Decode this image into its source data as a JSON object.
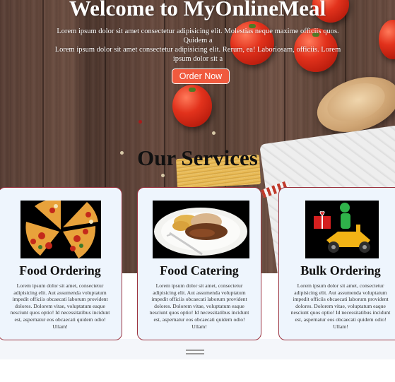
{
  "header": {
    "title": "Welcome to MyOnlineMeal",
    "intro_line1": "Lorem ipsum dolor sit amet consectetur adipisicing elit. Molestias neque maxime officiis quos. Quidem a",
    "intro_line2": "Lorem ipsum dolor sit amet consectetur adipisicing elit. Rerum, ea! Laboriosam, officiis. Lorem ipsum dolor sit a",
    "order_button": "Order Now"
  },
  "services": {
    "heading": "Our Services",
    "cards": [
      {
        "title": "Food Ordering",
        "icon": "pizza-image",
        "text": "Lorem ipsum dolor sit amet, consectetur adipisicing elit. Aut assumenda voluptatum impedit officiis obcaecati laborum provident dolores. Dolorem vitae, voluptatum eaque nesciunt quos optio! Id necessitatibus incidunt est, aspernatur eos obcaecati quidem odio! Ullam!"
      },
      {
        "title": "Food Catering",
        "icon": "plated-meal-image",
        "text": "Lorem ipsum dolor sit amet, consectetur adipisicing elit. Aut assumenda voluptatum impedit officiis obcaecati laborum provident dolores. Dolorem vitae, voluptatum eaque nesciunt quos optio! Id necessitatibus incidunt est, aspernatur eos obcaecati quidem odio! Ullam!"
      },
      {
        "title": "Bulk Ordering",
        "icon": "delivery-scooter-image",
        "text": "Lorem ipsum dolor sit amet, consectetur adipisicing elit. Aut assumenda voluptatum impedit officiis obcaecati laborum provident dolores. Dolorem vitae, voluptatum eaque nesciunt quos optio! Id necessitatibus incidunt est, aspernatur eos obcaecati quidem odio! Ullam!"
      }
    ]
  },
  "colors": {
    "button_bg": "#f05a3e",
    "card_bg": "#eef5fd",
    "card_border": "#9b3340"
  }
}
